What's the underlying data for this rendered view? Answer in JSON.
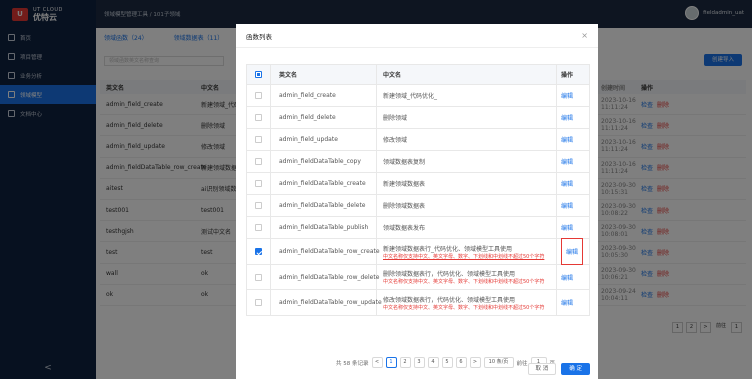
{
  "brand": {
    "logo_en": "UT CLOUD",
    "logo_cn": "优特云"
  },
  "sidebar": {
    "items": [
      {
        "label": "首页"
      },
      {
        "label": "项目管理"
      },
      {
        "label": "业务分析"
      },
      {
        "label": "领域模型"
      },
      {
        "label": "文档中心"
      }
    ],
    "collapse": "<"
  },
  "header": {
    "breadcrumb": "领域模型管理工具  /  101子领域",
    "user": "fieldadmin_uat"
  },
  "background": {
    "tabs": [
      "领域函数（24）",
      "领域数据表（11）"
    ],
    "search_placeholder": "领域函数英文名称查询",
    "add_label": "创建导入",
    "columns": [
      "英文名",
      "中文名",
      "创建时间",
      "操作"
    ],
    "rows": [
      {
        "en": "admin_field_create",
        "cn": "新建领域_代码",
        "time": "2023-10-16 11:11:24"
      },
      {
        "en": "admin_field_delete",
        "cn": "删除领域",
        "time": "2023-10-16 11:11:24"
      },
      {
        "en": "admin_field_update",
        "cn": "修改领域",
        "time": "2023-10-16 11:11:24"
      },
      {
        "en": "admin_fieldDataTable_row_create",
        "cn": "新建领域数据表行",
        "time": "2023-10-16 11:11:24"
      },
      {
        "en": "aitest",
        "cn": "ai识别领域数据",
        "time": "2023-09-30 10:15:31"
      },
      {
        "en": "test001",
        "cn": "test001",
        "time": "2023-09-30 10:08:22"
      },
      {
        "en": "testhgjsh",
        "cn": "测试中文名",
        "time": "2023-09-30 10:08:01"
      },
      {
        "en": "test",
        "cn": "test",
        "time": "2023-09-30 10:05:30"
      },
      {
        "en": "wall",
        "cn": "ok",
        "time": "2023-09-30 10:06:21"
      },
      {
        "en": "ok",
        "cn": "ok",
        "time": "2023-09-24 10:04:11"
      }
    ],
    "ops": [
      "检查",
      "删除"
    ],
    "pager": [
      "1",
      "2",
      ">",
      "前往",
      "1"
    ]
  },
  "modal": {
    "title": "函数列表",
    "close": "×",
    "columns": {
      "en": "英文名",
      "cn": "中文名",
      "op": "操作"
    },
    "rows": [
      {
        "en": "admin_field_create",
        "cn": "新建领域_代码优化_",
        "op": "编辑",
        "checked": false
      },
      {
        "en": "admin_field_delete",
        "cn": "删除领域",
        "op": "编辑",
        "checked": false
      },
      {
        "en": "admin_field_update",
        "cn": "修改领域",
        "op": "编辑",
        "checked": false
      },
      {
        "en": "admin_fieldDataTable_copy",
        "cn": "领域数据表复制",
        "op": "编辑",
        "checked": false
      },
      {
        "en": "admin_fieldDataTable_create",
        "cn": "新建领域数据表",
        "op": "编辑",
        "checked": false
      },
      {
        "en": "admin_fieldDataTable_delete",
        "cn": "删除领域数据表",
        "op": "编辑",
        "checked": false
      },
      {
        "en": "admin_fieldDataTable_publish",
        "cn": "领域数据表发布",
        "op": "编辑",
        "checked": false
      },
      {
        "en": "admin_fieldDataTable_row_create",
        "cn": "新建领域数据表行_代码优化、领域模型工具使用",
        "hint": "中文名称仅支持中文、英文字母、数字、下划线和中划线不超过50个字符",
        "op": "编辑",
        "checked": true
      },
      {
        "en": "admin_fieldDataTable_row_delete",
        "cn": "删除领域数据表行，代码优化、领域模型工具使用",
        "hint": "中文名称仅支持中文、英文字母、数字、下划线和中划线不超过50个字符",
        "op": "编辑",
        "checked": false
      },
      {
        "en": "admin_fieldDataTable_row_update",
        "cn": "修改领域数据表行，代码优化、领域模型工具使用",
        "hint": "中文名称仅支持中文、英文字母、数字、下划线和中划线不超过50个字符",
        "op": "编辑",
        "checked": false
      }
    ],
    "pager": {
      "total": "共 58 条记录",
      "prev": "<",
      "pages": [
        "1",
        "2",
        "3",
        "4",
        "5",
        "6"
      ],
      "next": ">",
      "size": "10 条/页",
      "jump_label": "前往",
      "jump_value": "1",
      "page_suffix": "页"
    },
    "buttons": {
      "cancel": "取 消",
      "confirm": "确 定"
    }
  },
  "colors": {
    "accent": "#1a73e8",
    "sidebar": "#0f2240",
    "error": "#e53935"
  }
}
